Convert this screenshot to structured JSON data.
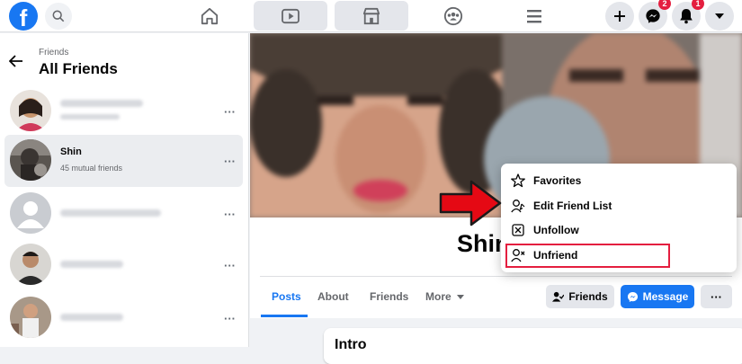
{
  "topbar": {
    "brand_letter": "f",
    "messenger_badge": "2",
    "notifications_badge": "1"
  },
  "sidebar": {
    "breadcrumb": "Friends",
    "title": "All Friends",
    "friends": [
      {
        "name": "",
        "subtitle": ""
      },
      {
        "name": "Shin",
        "subtitle": "45 mutual friends"
      },
      {
        "name": "",
        "subtitle": ""
      },
      {
        "name": "",
        "subtitle": ""
      },
      {
        "name": "",
        "subtitle": ""
      }
    ],
    "more_label": "···"
  },
  "profile": {
    "name": "Shin",
    "tabs": [
      "Posts",
      "About",
      "Friends",
      "More"
    ],
    "friends_button": "Friends",
    "message_button": "Message",
    "more_button": "···",
    "intro_title": "Intro"
  },
  "menu": {
    "items": [
      {
        "label": "Favorites",
        "icon": "star-icon"
      },
      {
        "label": "Edit Friend List",
        "icon": "edit-friend-list-icon"
      },
      {
        "label": "Unfollow",
        "icon": "unfollow-icon"
      },
      {
        "label": "Unfriend",
        "icon": "unfriend-icon"
      }
    ]
  },
  "colors": {
    "brand": "#1877f2",
    "highlight": "#e41e3f",
    "annotation_arrow": "#e50914"
  }
}
